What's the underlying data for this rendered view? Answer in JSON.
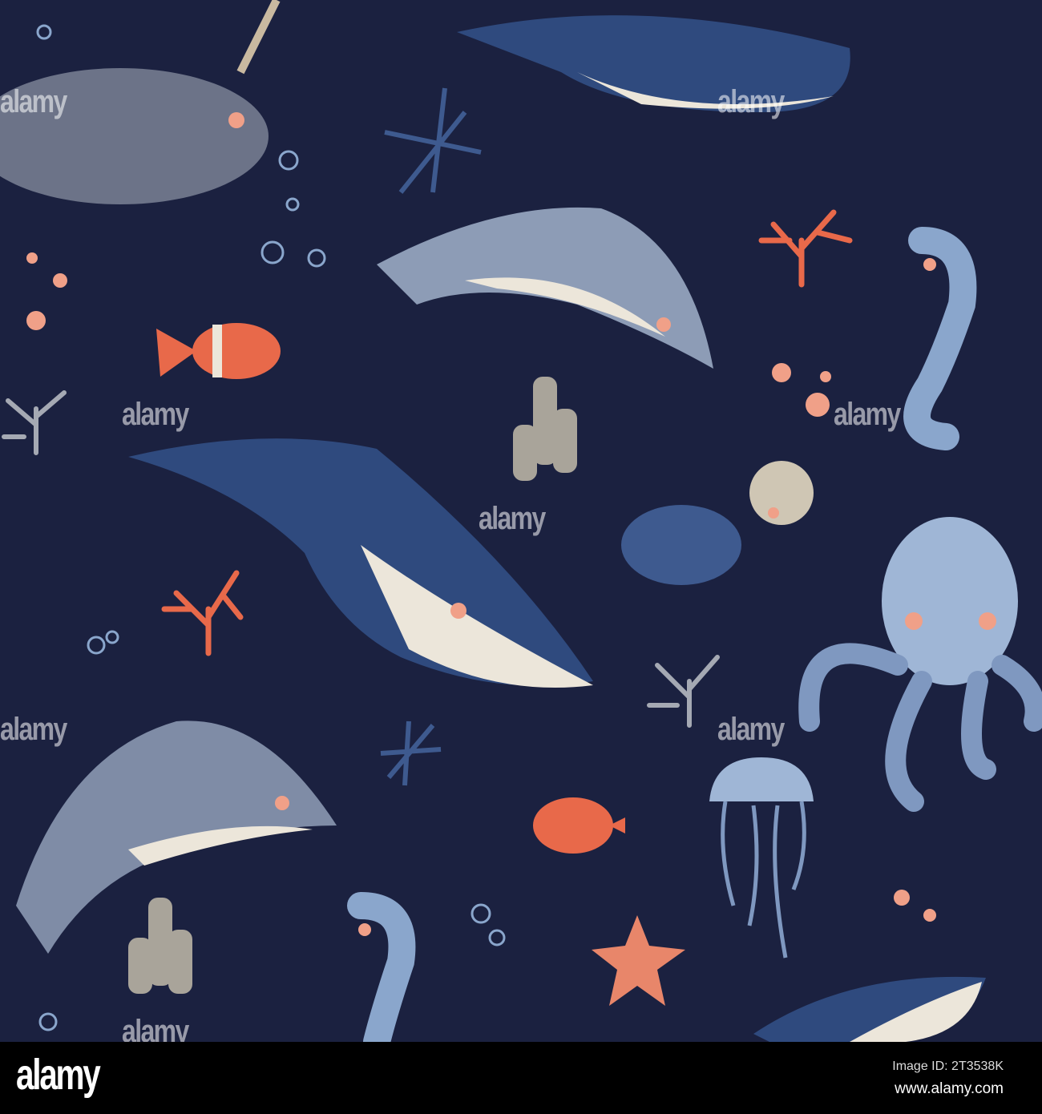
{
  "watermark": "alamy",
  "footer": {
    "logo": "alamy",
    "image_id": "Image ID: 2T3538K",
    "url": "www.alamy.com"
  },
  "colors": {
    "background": "#1b2140",
    "whale": "#2f4a7e",
    "dolphin": "#8d9cb6",
    "octopus": "#9fb6d6",
    "coral": "#e8694a",
    "cream": "#ece6da"
  }
}
